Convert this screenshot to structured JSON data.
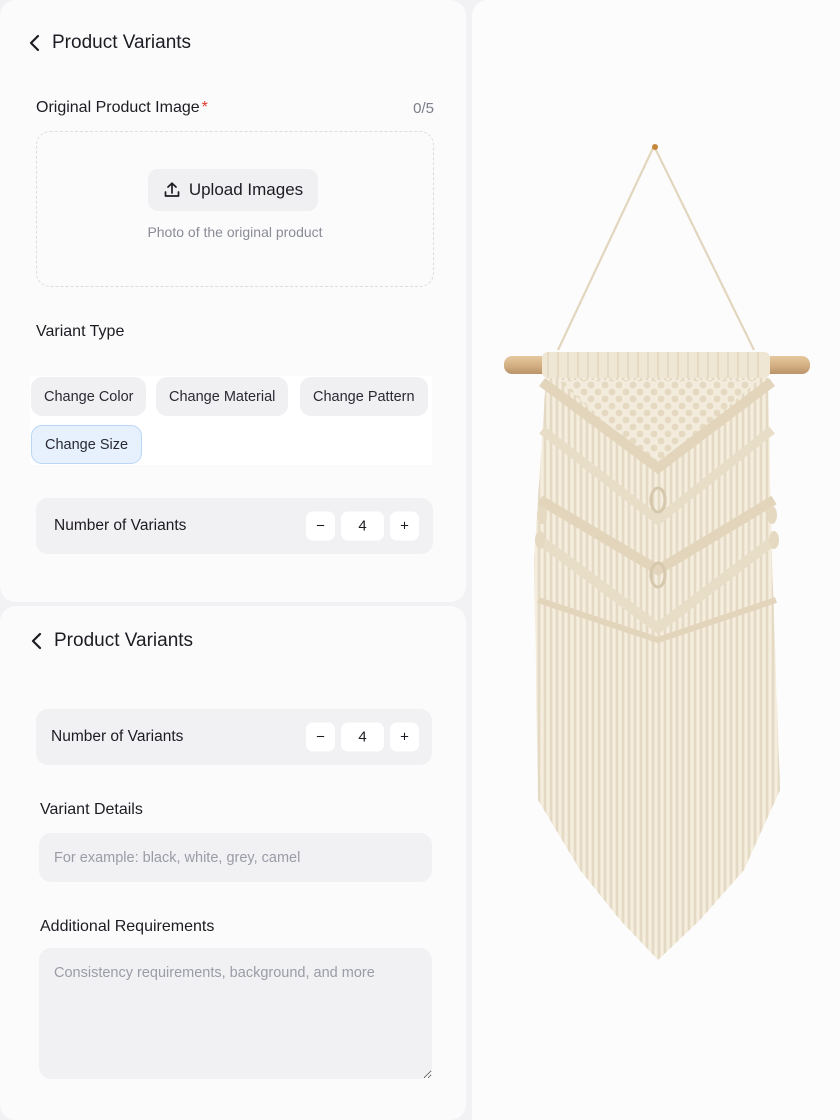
{
  "top_panel": {
    "title": "Product Variants",
    "original_image": {
      "label": "Original Product Image",
      "required_mark": "*",
      "counter": "0/5",
      "upload_button": "Upload Images",
      "hint": "Photo of the original product"
    },
    "variant_type": {
      "label": "Variant Type",
      "options": [
        "Change Color",
        "Change Material",
        "Change Pattern",
        "Change Size"
      ],
      "selected": "Change Size"
    },
    "number_of_variants": {
      "label": "Number of Variants",
      "decrement": "−",
      "value": "4",
      "increment": "+"
    }
  },
  "bottom_panel": {
    "title": "Product Variants",
    "number_of_variants": {
      "label": "Number of Variants",
      "decrement": "−",
      "value": "4",
      "increment": "+"
    },
    "variant_details": {
      "label": "Variant Details",
      "value": "",
      "placeholder": "For example: black, white, grey, camel"
    },
    "additional_requirements": {
      "label": "Additional Requirements",
      "value": "",
      "placeholder": "Consistency requirements, background, and more"
    }
  },
  "preview": {
    "image": "macrame-wall-hanging-photo"
  },
  "colors": {
    "accent_selected_bg": "#e6f1fd",
    "accent_selected_border": "#b9d6f6",
    "required": "#e0362c",
    "field_bg": "#f1f1f4",
    "cord": "#efe6d3",
    "dowel": "#d9b98c"
  }
}
